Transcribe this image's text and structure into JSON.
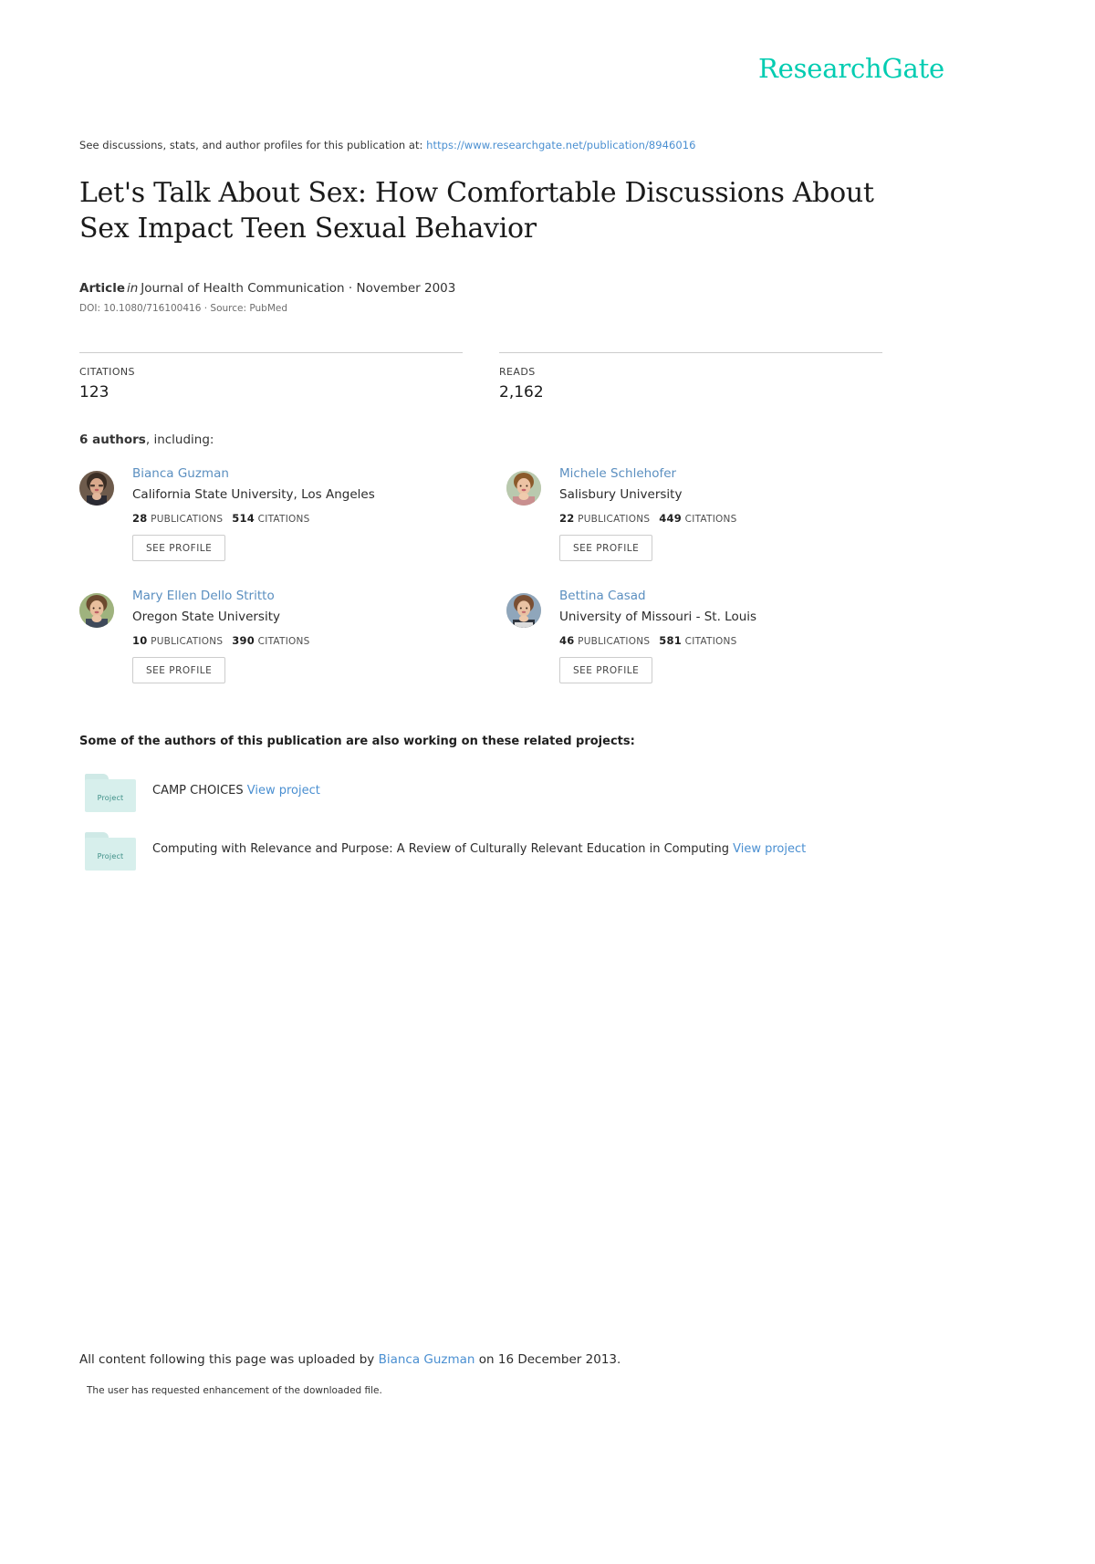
{
  "brand": {
    "logo_text": "ResearchGate",
    "accent_color": "#00ccb1",
    "link_color": "#4a8fd1"
  },
  "header": {
    "discussion_prefix": "See discussions, stats, and author profiles for this publication at:",
    "publication_url": "https://www.researchgate.net/publication/8946016"
  },
  "publication": {
    "title": "Let's Talk About Sex: How Comfortable Discussions About Sex Impact Teen Sexual Behavior",
    "type_label": "Article",
    "in_word": "in",
    "journal": "Journal of Health Communication · November 2003",
    "doi_line": "DOI: 10.1080/716100416 · Source: PubMed"
  },
  "stats": {
    "citations_label": "CITATIONS",
    "citations_value": "123",
    "reads_label": "READS",
    "reads_value": "2,162"
  },
  "authors_section": {
    "count_label": "6 authors",
    "including_label": ", including:",
    "see_profile_label": "SEE PROFILE",
    "publications_label": "PUBLICATIONS",
    "citations_label": "CITATIONS",
    "authors": [
      {
        "name": "Bianca Guzman",
        "affiliation": "California State University, Los Angeles",
        "publications": "28",
        "citations": "514"
      },
      {
        "name": "Michele Schlehofer",
        "affiliation": "Salisbury University",
        "publications": "22",
        "citations": "449"
      },
      {
        "name": "Mary Ellen Dello Stritto",
        "affiliation": "Oregon State University",
        "publications": "10",
        "citations": "390"
      },
      {
        "name": "Bettina Casad",
        "affiliation": "University of Missouri - St. Louis",
        "publications": "46",
        "citations": "581"
      }
    ]
  },
  "projects_section": {
    "heading": "Some of the authors of this publication are also working on these related projects:",
    "folder_label": "Project",
    "view_label": "View project",
    "projects": [
      {
        "title": "CAMP CHOICES"
      },
      {
        "title": "Computing with Relevance and Purpose: A Review of Culturally Relevant Education in Computing"
      }
    ]
  },
  "footer": {
    "uploaded_prefix": "All content following this page was uploaded by",
    "uploader": "Bianca Guzman",
    "uploaded_suffix": "on 16 December 2013.",
    "enhancement_note": "The user has requested enhancement of the downloaded file."
  }
}
